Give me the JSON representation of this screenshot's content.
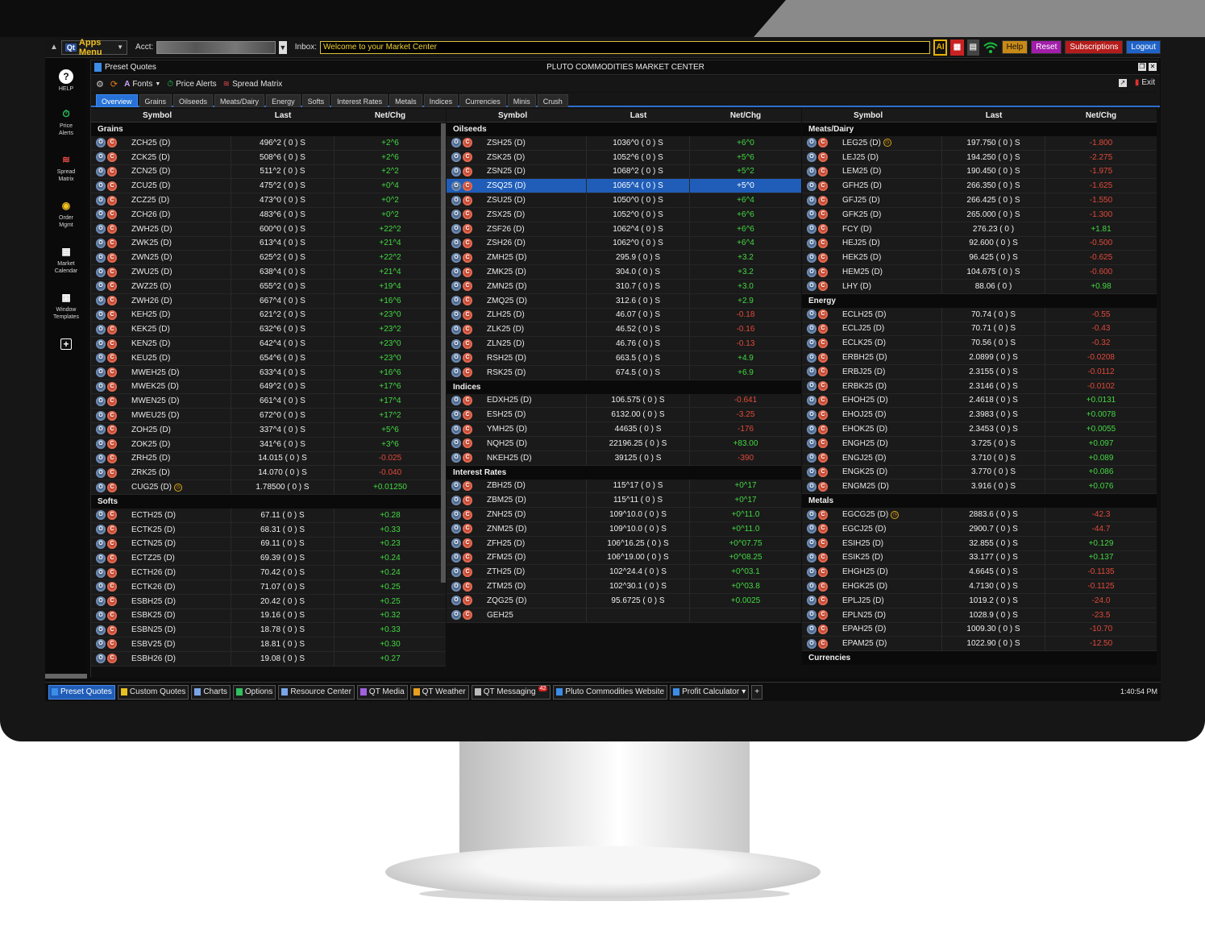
{
  "topbar": {
    "apps_menu_label": "Apps Menu",
    "apps_logo": "Qt",
    "acct_label": "Acct:",
    "inbox_label": "Inbox:",
    "inbox_value": "Welcome to your Market Center",
    "ai_label": "AI",
    "buttons": {
      "help": "Help",
      "reset": "Reset",
      "subscriptions": "Subscriptions",
      "logout": "Logout"
    }
  },
  "rail": [
    {
      "label": "HELP",
      "icon": "help-icon"
    },
    {
      "label": "Price Alerts",
      "icon": "price-alerts-icon"
    },
    {
      "label": "Spread Matrix",
      "icon": "spread-matrix-icon"
    },
    {
      "label": "Order Mgmt",
      "icon": "order-mgmt-icon"
    },
    {
      "label": "Market Calendar",
      "icon": "market-calendar-icon"
    },
    {
      "label": "Window Templates",
      "icon": "window-templates-icon"
    }
  ],
  "panel": {
    "title": "Preset Quotes",
    "center_title": "PLUTO COMMODITIES MARKET CENTER",
    "toolbar": {
      "fonts": "Fonts",
      "price_alerts": "Price Alerts",
      "spread_matrix": "Spread Matrix",
      "exit": "Exit"
    },
    "tabs": [
      "Overview",
      "Grains",
      "Oilseeds",
      "Meats/Dairy",
      "Energy",
      "Softs",
      "Interest Rates",
      "Metals",
      "Indices",
      "Currencies",
      "Minis",
      "Crush"
    ],
    "headers": {
      "symbol": "Symbol",
      "last": "Last",
      "net": "Net/Chg"
    }
  },
  "columns": [
    {
      "sections": [
        {
          "name": "Grains",
          "rows": [
            {
              "s": "ZCH25 (D)",
              "l": "496^2 ( 0 )  S",
              "n": "+2^6",
              "p": true
            },
            {
              "s": "ZCK25 (D)",
              "l": "508^6 ( 0 )  S",
              "n": "+2^6",
              "p": true
            },
            {
              "s": "ZCN25 (D)",
              "l": "511^2 ( 0 )  S",
              "n": "+2^2",
              "p": true
            },
            {
              "s": "ZCU25 (D)",
              "l": "475^2 ( 0 )  S",
              "n": "+0^4",
              "p": true
            },
            {
              "s": "ZCZ25 (D)",
              "l": "473^0 ( 0 )  S",
              "n": "+0^2",
              "p": true
            },
            {
              "s": "ZCH26 (D)",
              "l": "483^6 ( 0 )  S",
              "n": "+0^2",
              "p": true
            },
            {
              "s": "ZWH25 (D)",
              "l": "600^0 ( 0 )  S",
              "n": "+22^2",
              "p": true
            },
            {
              "s": "ZWK25 (D)",
              "l": "613^4 ( 0 )  S",
              "n": "+21^4",
              "p": true
            },
            {
              "s": "ZWN25 (D)",
              "l": "625^2 ( 0 )  S",
              "n": "+22^2",
              "p": true
            },
            {
              "s": "ZWU25 (D)",
              "l": "638^4 ( 0 )  S",
              "n": "+21^4",
              "p": true
            },
            {
              "s": "ZWZ25 (D)",
              "l": "655^2 ( 0 )  S",
              "n": "+19^4",
              "p": true
            },
            {
              "s": "ZWH26 (D)",
              "l": "667^4 ( 0 )  S",
              "n": "+16^6",
              "p": true
            },
            {
              "s": "KEH25 (D)",
              "l": "621^2 ( 0 )  S",
              "n": "+23^0",
              "p": true
            },
            {
              "s": "KEK25 (D)",
              "l": "632^6 ( 0 )  S",
              "n": "+23^2",
              "p": true
            },
            {
              "s": "KEN25 (D)",
              "l": "642^4 ( 0 )  S",
              "n": "+23^0",
              "p": true
            },
            {
              "s": "KEU25 (D)",
              "l": "654^6 ( 0 )  S",
              "n": "+23^0",
              "p": true
            },
            {
              "s": "MWEH25 (D)",
              "l": "633^4 ( 0 )  S",
              "n": "+16^6",
              "p": true
            },
            {
              "s": "MWEK25 (D)",
              "l": "649^2 ( 0 )  S",
              "n": "+17^6",
              "p": true
            },
            {
              "s": "MWEN25 (D)",
              "l": "661^4 ( 0 )  S",
              "n": "+17^4",
              "p": true
            },
            {
              "s": "MWEU25 (D)",
              "l": "672^0 ( 0 )  S",
              "n": "+17^2",
              "p": true
            },
            {
              "s": "ZOH25 (D)",
              "l": "337^4 ( 0 )  S",
              "n": "+5^6",
              "p": true
            },
            {
              "s": "ZOK25 (D)",
              "l": "341^6 ( 0 )  S",
              "n": "+3^6",
              "p": true
            },
            {
              "s": "ZRH25 (D)",
              "l": "14.015 ( 0 )  S",
              "n": "-0.025",
              "p": false
            },
            {
              "s": "ZRK25 (D)",
              "l": "14.070 ( 0 )  S",
              "n": "-0.040",
              "p": false
            },
            {
              "s": "CUG25 (D)",
              "l": "1.78500 ( 0 )  S",
              "n": "+0.01250",
              "p": true,
              "clock": true
            }
          ]
        },
        {
          "name": "Softs",
          "rows": [
            {
              "s": "ECTH25 (D)",
              "l": "67.11 ( 0 )  S",
              "n": "+0.28",
              "p": true
            },
            {
              "s": "ECTK25 (D)",
              "l": "68.31 ( 0 )  S",
              "n": "+0.33",
              "p": true
            },
            {
              "s": "ECTN25 (D)",
              "l": "69.11 ( 0 )  S",
              "n": "+0.23",
              "p": true
            },
            {
              "s": "ECTZ25 (D)",
              "l": "69.39 ( 0 )  S",
              "n": "+0.24",
              "p": true
            },
            {
              "s": "ECTH26 (D)",
              "l": "70.42 ( 0 )  S",
              "n": "+0.24",
              "p": true
            },
            {
              "s": "ECTK26 (D)",
              "l": "71.07 ( 0 )  S",
              "n": "+0.25",
              "p": true
            },
            {
              "s": "ESBH25 (D)",
              "l": "20.42 ( 0 )  S",
              "n": "+0.25",
              "p": true
            },
            {
              "s": "ESBK25 (D)",
              "l": "19.16 ( 0 )  S",
              "n": "+0.32",
              "p": true
            },
            {
              "s": "ESBN25 (D)",
              "l": "18.78 ( 0 )  S",
              "n": "+0.33",
              "p": true
            },
            {
              "s": "ESBV25 (D)",
              "l": "18.81 ( 0 )  S",
              "n": "+0.30",
              "p": true
            },
            {
              "s": "ESBH26 (D)",
              "l": "19.08 ( 0 )  S",
              "n": "+0.27",
              "p": true
            }
          ]
        }
      ]
    },
    {
      "sections": [
        {
          "name": "Oilseeds",
          "rows": [
            {
              "s": "ZSH25 (D)",
              "l": "1036^0 ( 0 )  S",
              "n": "+6^0",
              "p": true
            },
            {
              "s": "ZSK25 (D)",
              "l": "1052^6 ( 0 )  S",
              "n": "+5^6",
              "p": true
            },
            {
              "s": "ZSN25 (D)",
              "l": "1068^2 ( 0 )  S",
              "n": "+5^2",
              "p": true
            },
            {
              "s": "ZSQ25 (D)",
              "l": "1065^4 ( 0 )  S",
              "n": "+5^0",
              "p": true,
              "sel": true
            },
            {
              "s": "ZSU25 (D)",
              "l": "1050^0 ( 0 )  S",
              "n": "+6^4",
              "p": true
            },
            {
              "s": "ZSX25 (D)",
              "l": "1052^0 ( 0 )  S",
              "n": "+6^6",
              "p": true
            },
            {
              "s": "ZSF26 (D)",
              "l": "1062^4 ( 0 )  S",
              "n": "+6^6",
              "p": true
            },
            {
              "s": "ZSH26 (D)",
              "l": "1062^0 ( 0 )  S",
              "n": "+6^4",
              "p": true
            },
            {
              "s": "ZMH25 (D)",
              "l": "295.9 ( 0 )  S",
              "n": "+3.2",
              "p": true
            },
            {
              "s": "ZMK25 (D)",
              "l": "304.0 ( 0 )  S",
              "n": "+3.2",
              "p": true
            },
            {
              "s": "ZMN25 (D)",
              "l": "310.7 ( 0 )  S",
              "n": "+3.0",
              "p": true
            },
            {
              "s": "ZMQ25 (D)",
              "l": "312.6 ( 0 )  S",
              "n": "+2.9",
              "p": true
            },
            {
              "s": "ZLH25 (D)",
              "l": "46.07 ( 0 )  S",
              "n": "-0.18",
              "p": false
            },
            {
              "s": "ZLK25 (D)",
              "l": "46.52 ( 0 )  S",
              "n": "-0.16",
              "p": false
            },
            {
              "s": "ZLN25 (D)",
              "l": "46.76 ( 0 )  S",
              "n": "-0.13",
              "p": false
            },
            {
              "s": "RSH25 (D)",
              "l": "663.5 ( 0 )  S",
              "n": "+4.9",
              "p": true
            },
            {
              "s": "RSK25 (D)",
              "l": "674.5 ( 0 )  S",
              "n": "+6.9",
              "p": true
            }
          ]
        },
        {
          "name": "Indices",
          "rows": [
            {
              "s": "EDXH25 (D)",
              "l": "106.575 ( 0 )  S",
              "n": "-0.641",
              "p": false
            },
            {
              "s": "ESH25 (D)",
              "l": "6132.00 ( 0 )  S",
              "n": "-3.25",
              "p": false
            },
            {
              "s": "YMH25 (D)",
              "l": "44635 ( 0 )  S",
              "n": "-176",
              "p": false
            },
            {
              "s": "NQH25 (D)",
              "l": "22196.25 ( 0 )  S",
              "n": "+83.00",
              "p": true
            },
            {
              "s": "NKEH25 (D)",
              "l": "39125 ( 0 )  S",
              "n": "-390",
              "p": false
            }
          ]
        },
        {
          "name": "Interest Rates",
          "rows": [
            {
              "s": "ZBH25 (D)",
              "l": "115^17 ( 0 )  S",
              "n": "+0^17",
              "p": true
            },
            {
              "s": "ZBM25 (D)",
              "l": "115^11 ( 0 )  S",
              "n": "+0^17",
              "p": true
            },
            {
              "s": "ZNH25 (D)",
              "l": "109^10.0 ( 0 )  S",
              "n": "+0^11.0",
              "p": true
            },
            {
              "s": "ZNM25 (D)",
              "l": "109^10.0 ( 0 )  S",
              "n": "+0^11.0",
              "p": true
            },
            {
              "s": "ZFH25 (D)",
              "l": "106^16.25 ( 0 )  S",
              "n": "+0^07.75",
              "p": true
            },
            {
              "s": "ZFM25 (D)",
              "l": "106^19.00 ( 0 )  S",
              "n": "+0^08.25",
              "p": true
            },
            {
              "s": "ZTH25 (D)",
              "l": "102^24.4 ( 0 )  S",
              "n": "+0^03.1",
              "p": true
            },
            {
              "s": "ZTM25 (D)",
              "l": "102^30.1 ( 0 )  S",
              "n": "+0^03.8",
              "p": true
            },
            {
              "s": "ZQG25 (D)",
              "l": "95.6725 ( 0 )  S",
              "n": "+0.0025",
              "p": true
            },
            {
              "s": "GEH25",
              "l": "",
              "n": "",
              "p": true
            }
          ]
        }
      ]
    },
    {
      "sections": [
        {
          "name": "Meats/Dairy",
          "rows": [
            {
              "s": "LEG25 (D)",
              "l": "197.750 ( 0 )  S",
              "n": "-1.800",
              "p": false,
              "clock": true
            },
            {
              "s": "LEJ25 (D)",
              "l": "194.250 ( 0 )  S",
              "n": "-2.275",
              "p": false
            },
            {
              "s": "LEM25 (D)",
              "l": "190.450 ( 0 )  S",
              "n": "-1.975",
              "p": false
            },
            {
              "s": "GFH25 (D)",
              "l": "266.350 ( 0 )  S",
              "n": "-1.625",
              "p": false
            },
            {
              "s": "GFJ25 (D)",
              "l": "266.425 ( 0 )  S",
              "n": "-1.550",
              "p": false
            },
            {
              "s": "GFK25 (D)",
              "l": "265.000 ( 0 )  S",
              "n": "-1.300",
              "p": false
            },
            {
              "s": "FCY (D)",
              "l": "276.23 ( 0 )",
              "n": "+1.81",
              "p": true
            },
            {
              "s": "HEJ25 (D)",
              "l": "92.600 ( 0 )  S",
              "n": "-0.500",
              "p": false
            },
            {
              "s": "HEK25 (D)",
              "l": "96.425 ( 0 )  S",
              "n": "-0.625",
              "p": false
            },
            {
              "s": "HEM25 (D)",
              "l": "104.675 ( 0 )  S",
              "n": "-0.600",
              "p": false
            },
            {
              "s": "LHY (D)",
              "l": "88.06 ( 0 )",
              "n": "+0.98",
              "p": true
            }
          ]
        },
        {
          "name": "Energy",
          "rows": [
            {
              "s": "ECLH25 (D)",
              "l": "70.74 ( 0 )  S",
              "n": "-0.55",
              "p": false
            },
            {
              "s": "ECLJ25 (D)",
              "l": "70.71 ( 0 )  S",
              "n": "-0.43",
              "p": false
            },
            {
              "s": "ECLK25 (D)",
              "l": "70.56 ( 0 )  S",
              "n": "-0.32",
              "p": false
            },
            {
              "s": "ERBH25 (D)",
              "l": "2.0899 ( 0 )  S",
              "n": "-0.0208",
              "p": false
            },
            {
              "s": "ERBJ25 (D)",
              "l": "2.3155 ( 0 )  S",
              "n": "-0.0112",
              "p": false
            },
            {
              "s": "ERBK25 (D)",
              "l": "2.3146 ( 0 )  S",
              "n": "-0.0102",
              "p": false
            },
            {
              "s": "EHOH25 (D)",
              "l": "2.4618 ( 0 )  S",
              "n": "+0.0131",
              "p": true
            },
            {
              "s": "EHOJ25 (D)",
              "l": "2.3983 ( 0 )  S",
              "n": "+0.0078",
              "p": true
            },
            {
              "s": "EHOK25 (D)",
              "l": "2.3453 ( 0 )  S",
              "n": "+0.0055",
              "p": true
            },
            {
              "s": "ENGH25 (D)",
              "l": "3.725 ( 0 )  S",
              "n": "+0.097",
              "p": true
            },
            {
              "s": "ENGJ25 (D)",
              "l": "3.710 ( 0 )  S",
              "n": "+0.089",
              "p": true
            },
            {
              "s": "ENGK25 (D)",
              "l": "3.770 ( 0 )  S",
              "n": "+0.086",
              "p": true
            },
            {
              "s": "ENGM25 (D)",
              "l": "3.916 ( 0 )  S",
              "n": "+0.076",
              "p": true
            }
          ]
        },
        {
          "name": "Metals",
          "rows": [
            {
              "s": "EGCG25 (D)",
              "l": "2883.6 ( 0 )  S",
              "n": "-42.3",
              "p": false,
              "clock": true
            },
            {
              "s": "EGCJ25 (D)",
              "l": "2900.7 ( 0 )  S",
              "n": "-44.7",
              "p": false
            },
            {
              "s": "ESIH25 (D)",
              "l": "32.855 ( 0 )  S",
              "n": "+0.129",
              "p": true
            },
            {
              "s": "ESIK25 (D)",
              "l": "33.177 ( 0 )  S",
              "n": "+0.137",
              "p": true
            },
            {
              "s": "EHGH25 (D)",
              "l": "4.6645 ( 0 )  S",
              "n": "-0.1135",
              "p": false
            },
            {
              "s": "EHGK25 (D)",
              "l": "4.7130 ( 0 )  S",
              "n": "-0.1125",
              "p": false
            },
            {
              "s": "EPLJ25 (D)",
              "l": "1019.2 ( 0 )  S",
              "n": "-24.0",
              "p": false
            },
            {
              "s": "EPLN25 (D)",
              "l": "1028.9 ( 0 )  S",
              "n": "-23.5",
              "p": false
            },
            {
              "s": "EPAH25 (D)",
              "l": "1009.30 ( 0 )  S",
              "n": "-10.70",
              "p": false
            },
            {
              "s": "EPAM25 (D)",
              "l": "1022.90 ( 0 )  S",
              "n": "-12.50",
              "p": false
            }
          ]
        },
        {
          "name": "Currencies",
          "rows": []
        }
      ]
    }
  ],
  "taskbar": {
    "items": [
      {
        "label": "Preset Quotes",
        "active": true,
        "icon": "#3b8de8"
      },
      {
        "label": "Custom Quotes",
        "icon": "#e8c020"
      },
      {
        "label": "Charts",
        "icon": "#7aa6e8"
      },
      {
        "label": "Options",
        "icon": "#30c060"
      },
      {
        "label": "Resource Center",
        "icon": "#7aa6e8"
      },
      {
        "label": "QT Media",
        "icon": "#a060e0"
      },
      {
        "label": "QT Weather",
        "icon": "#e8a020"
      },
      {
        "label": "QT Messaging",
        "icon": "#bbbbbb",
        "badge": "42"
      },
      {
        "label": "Pluto Commodities Website",
        "icon": "#3b8de8"
      },
      {
        "label": "Profit Calculator",
        "icon": "#3b8de8"
      }
    ],
    "plus": "+",
    "time": "1:40:54 PM"
  }
}
